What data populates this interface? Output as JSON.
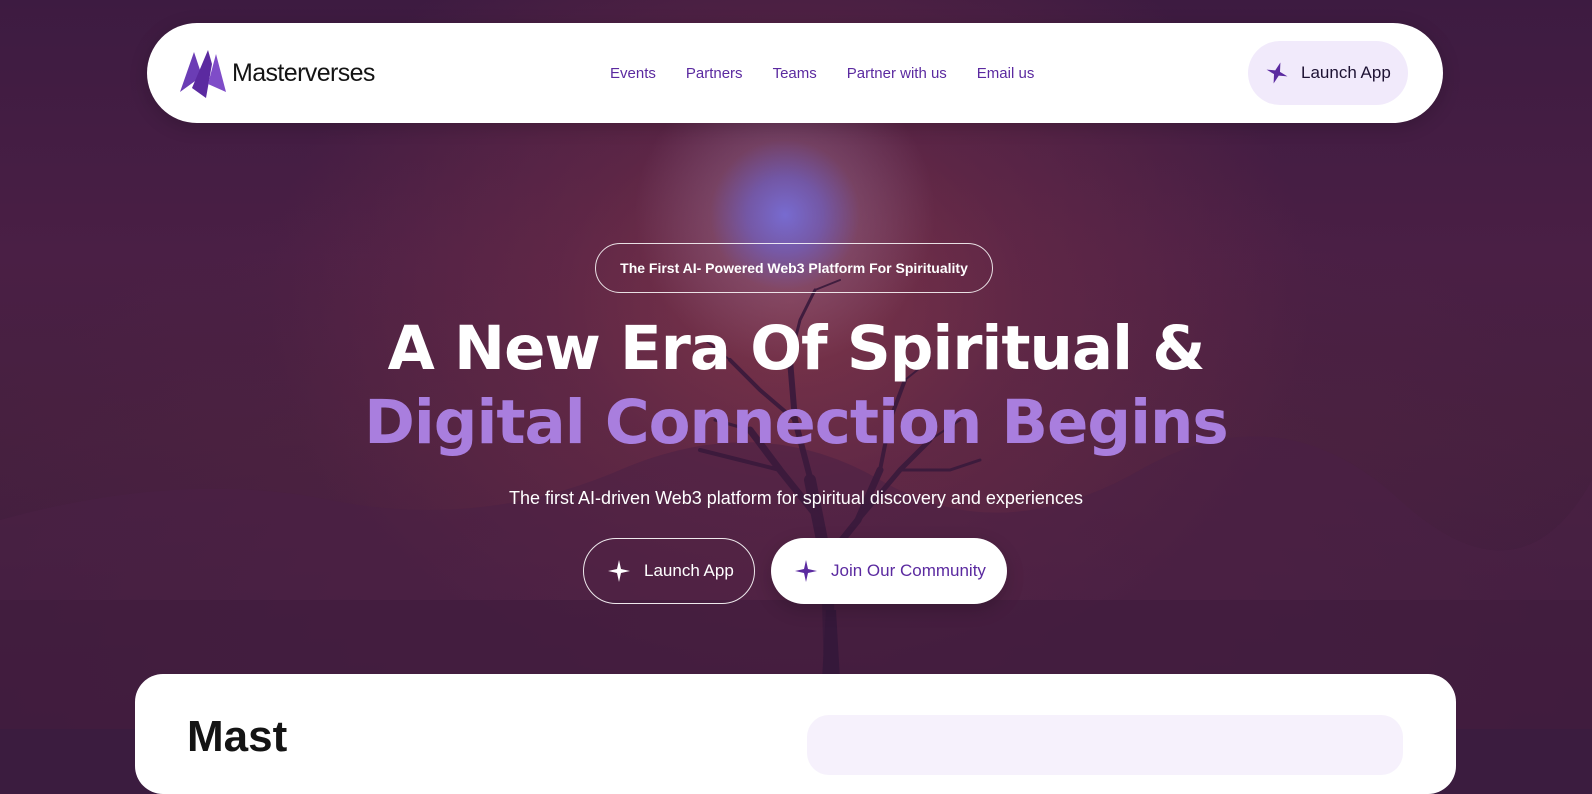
{
  "header": {
    "brand": "Masterverses",
    "nav": [
      {
        "label": "Events"
      },
      {
        "label": "Partners"
      },
      {
        "label": "Teams"
      },
      {
        "label": "Partner with us"
      },
      {
        "label": "Email us"
      }
    ],
    "launch_button": "Launch App"
  },
  "hero": {
    "tagline": "The First AI- Powered Web3 Platform For Spirituality",
    "headline_line1": "A New Era Of Spiritual &",
    "headline_line2": "Digital Connection Begins",
    "subtitle": "The first AI-driven Web3 platform for spiritual discovery and experiences",
    "primary_button": "Launch App",
    "secondary_button": "Join Our Community"
  },
  "next_section": {
    "heading_partial": "Mast"
  },
  "colors": {
    "brand_purple": "#5b2aa0",
    "headline_accent": "#a97ede",
    "nav_button_bg": "#f1eafb"
  },
  "icons": {
    "logo": "masterverses-logo-icon",
    "launch": "sparkle-star-icon"
  }
}
